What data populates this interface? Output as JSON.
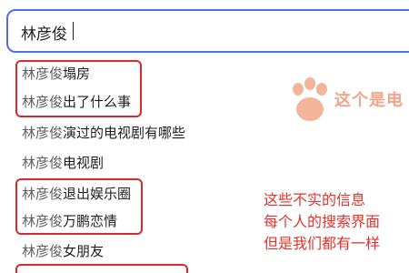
{
  "search": {
    "query": "林彦俊"
  },
  "suggestions": [
    {
      "prefix": "林彦俊",
      "rest": "塌房"
    },
    {
      "prefix": "林彦俊",
      "rest": "出了什么事"
    },
    {
      "prefix": "林彦俊",
      "rest": "演过的电视剧有哪些"
    },
    {
      "prefix": "林彦俊",
      "rest": "电视剧"
    },
    {
      "prefix": "林彦俊",
      "rest": "退出娱乐圈"
    },
    {
      "prefix": "林彦俊",
      "rest": "万鹏恋情"
    },
    {
      "prefix": "林彦俊",
      "rest": "女朋友"
    }
  ],
  "watermark": {
    "text": "这个是电",
    "icon": "paw-icon"
  },
  "annotation": {
    "line1": "这些不实的信息",
    "line2": "每个人的搜索界面",
    "line3": "但是我们都有一样"
  },
  "colors": {
    "highlight": "#d8292c",
    "annotation": "#e0342c",
    "search_border": "#4e6ef2",
    "watermark": "#f2a58a"
  }
}
